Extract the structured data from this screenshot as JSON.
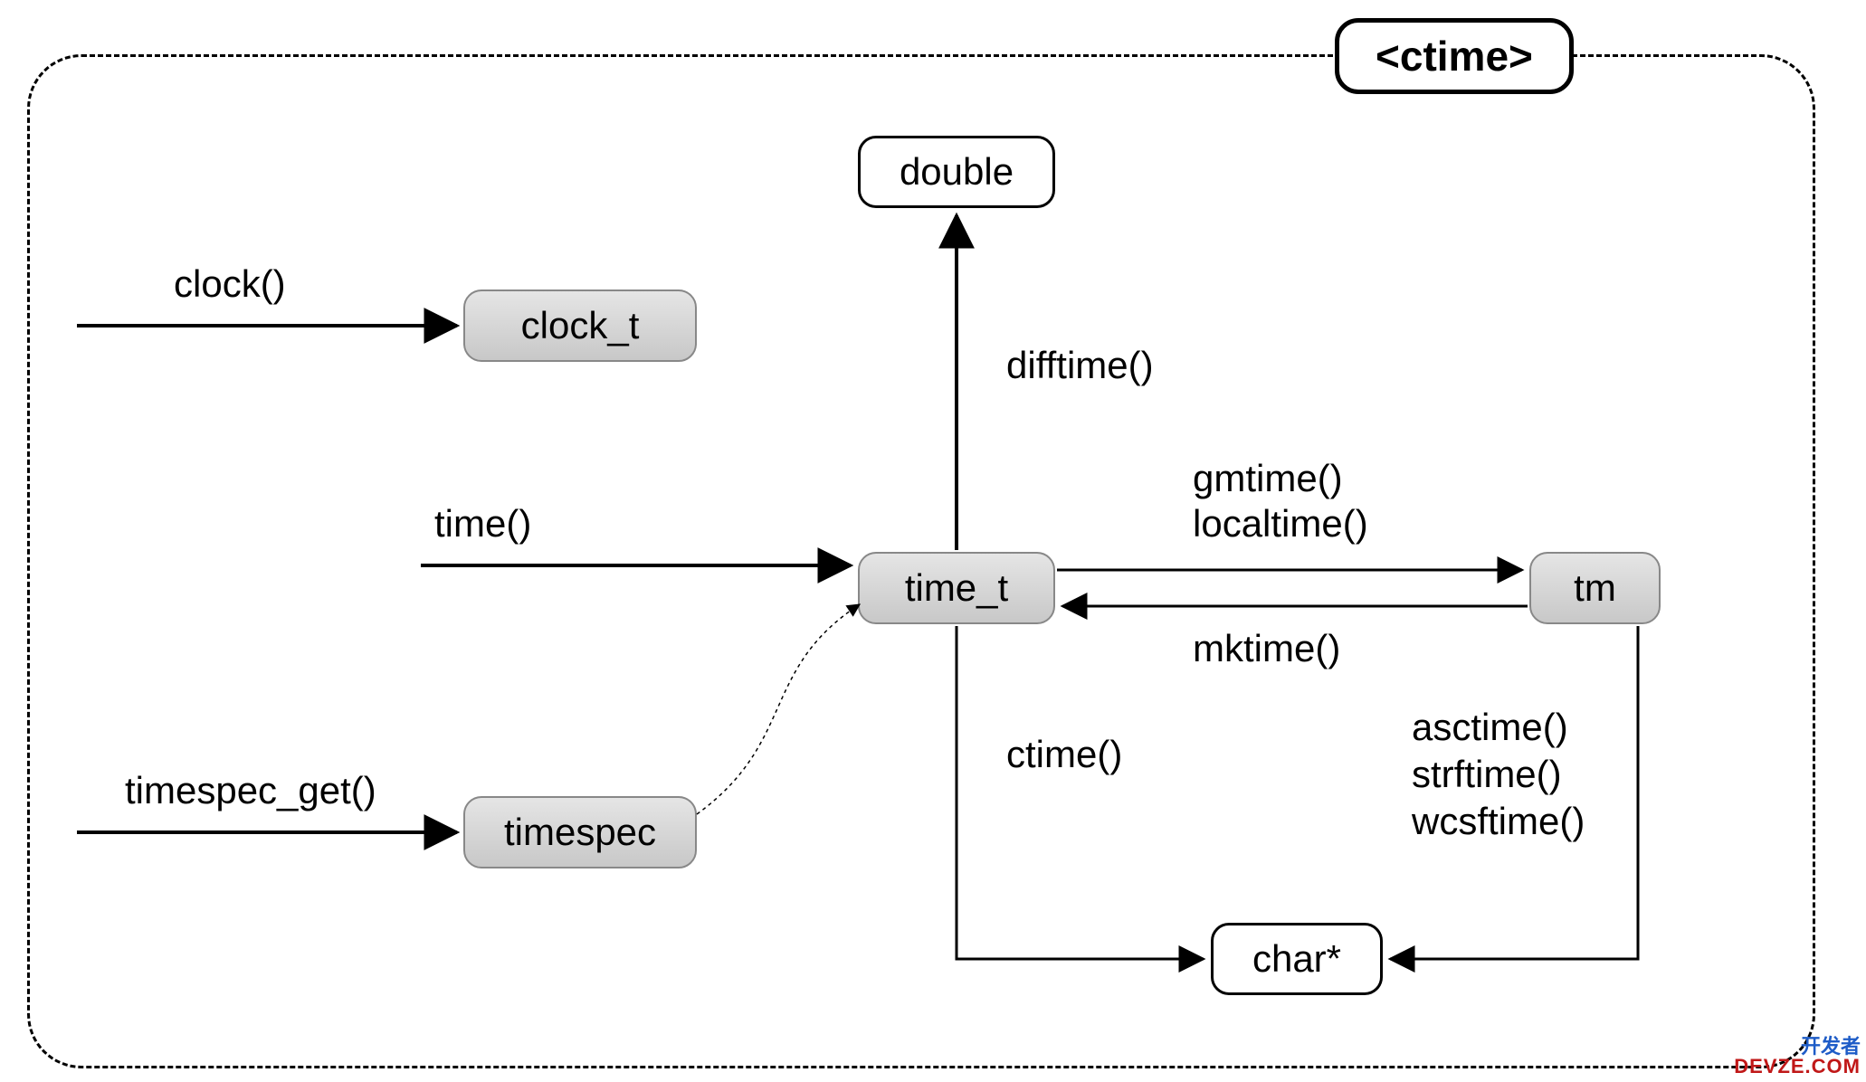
{
  "title": "<ctime>",
  "nodes": {
    "clock_t": "clock_t",
    "timespec": "timespec",
    "double": "double",
    "time_t": "time_t",
    "tm": "tm",
    "char": "char*"
  },
  "labels": {
    "clock": "clock()",
    "time": "time()",
    "timespec_get": "timespec_get()",
    "difftime": "difftime()",
    "gmtime": "gmtime()",
    "localtime": "localtime()",
    "mktime": "mktime()",
    "ctime": "ctime()",
    "asctime": "asctime()",
    "strftime": "strftime()",
    "wcsftime": "wcsftime()"
  },
  "watermark": {
    "line1": "开发者",
    "line2": "DEVZE.COM"
  }
}
